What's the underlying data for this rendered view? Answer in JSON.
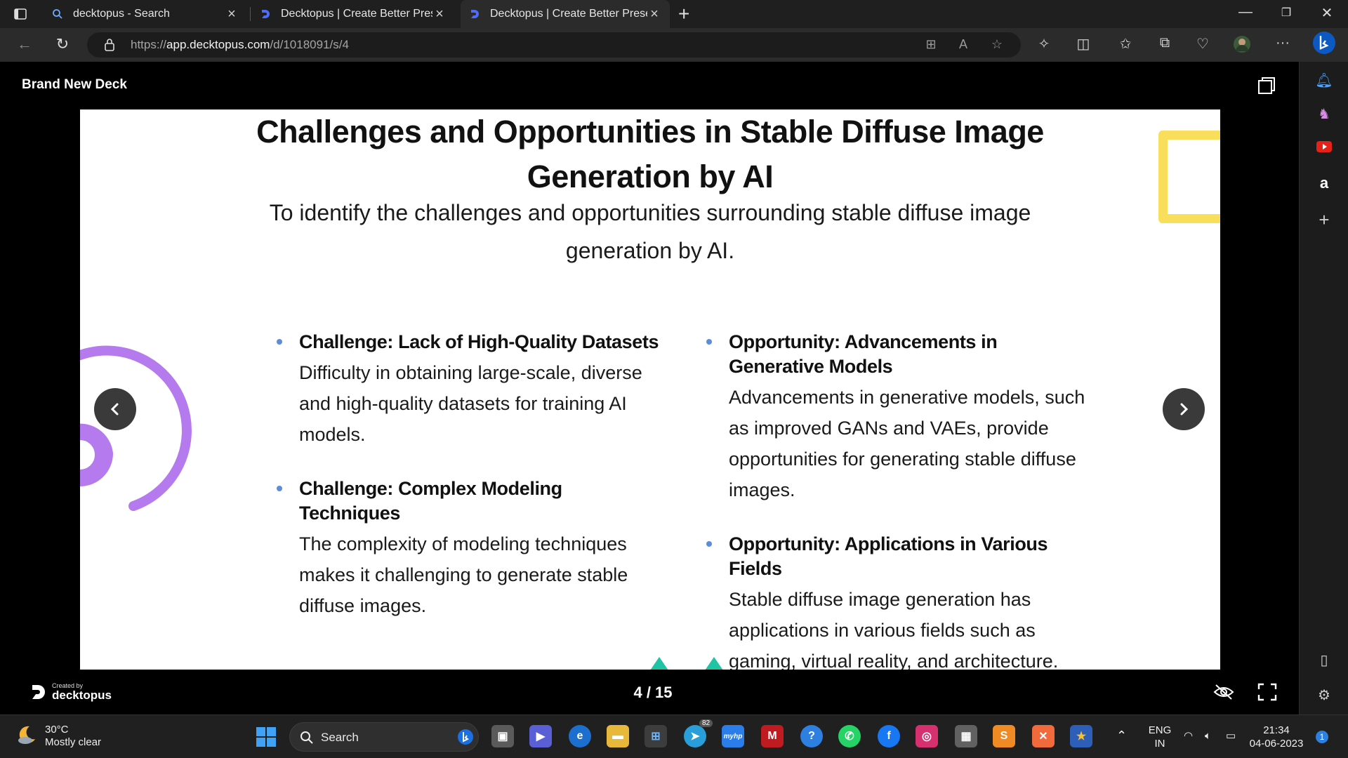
{
  "browser": {
    "tabs": [
      {
        "title": "decktopus - Search",
        "active": false
      },
      {
        "title": "Decktopus | Create Better Presen",
        "active": false
      },
      {
        "title": "Decktopus | Create Better Presen",
        "active": true
      }
    ],
    "url_prefix": "https://",
    "url_host": "app.decktopus.com",
    "url_path": "/d/1018091/s/4"
  },
  "app": {
    "deck_title": "Brand New Deck",
    "footer": {
      "created_by": "Created by",
      "brand": "decktopus",
      "page_indicator": "4 / 15"
    }
  },
  "slide": {
    "title": "Challenges and Opportunities in Stable Diffuse Image Generation by AI",
    "subtitle": "To identify the challenges and opportunities surrounding stable diffuse image generation by AI.",
    "left_items": [
      {
        "heading": "Challenge: Lack of High-Quality Datasets",
        "body": "Difficulty in obtaining large-scale, diverse and high-quality datasets for training AI models."
      },
      {
        "heading": "Challenge: Complex Modeling Techniques",
        "body": "The complexity of modeling techniques makes it challenging to generate stable diffuse images."
      }
    ],
    "right_items": [
      {
        "heading": "Opportunity: Advancements in Generative Models",
        "body": "Advancements in generative models, such as improved GANs and VAEs, provide opportunities for generating stable diffuse images."
      },
      {
        "heading": "Opportunity: Applications in Various Fields",
        "body": "Stable diffuse image generation has applications in various fields such as gaming, virtual reality, and architecture."
      }
    ],
    "colors": {
      "bullet": "#5b8dd8",
      "yellow": "#f9de5b",
      "purple": "#b57bee",
      "teal": "#20c4a4"
    }
  },
  "taskbar": {
    "weather_temp": "30°C",
    "weather_desc": "Mostly clear",
    "search_label": "Search",
    "telegram_badge": "82",
    "lang_line1": "ENG",
    "lang_line2": "IN",
    "time": "21:34",
    "date": "04-06-2023",
    "notification_count": "1"
  }
}
